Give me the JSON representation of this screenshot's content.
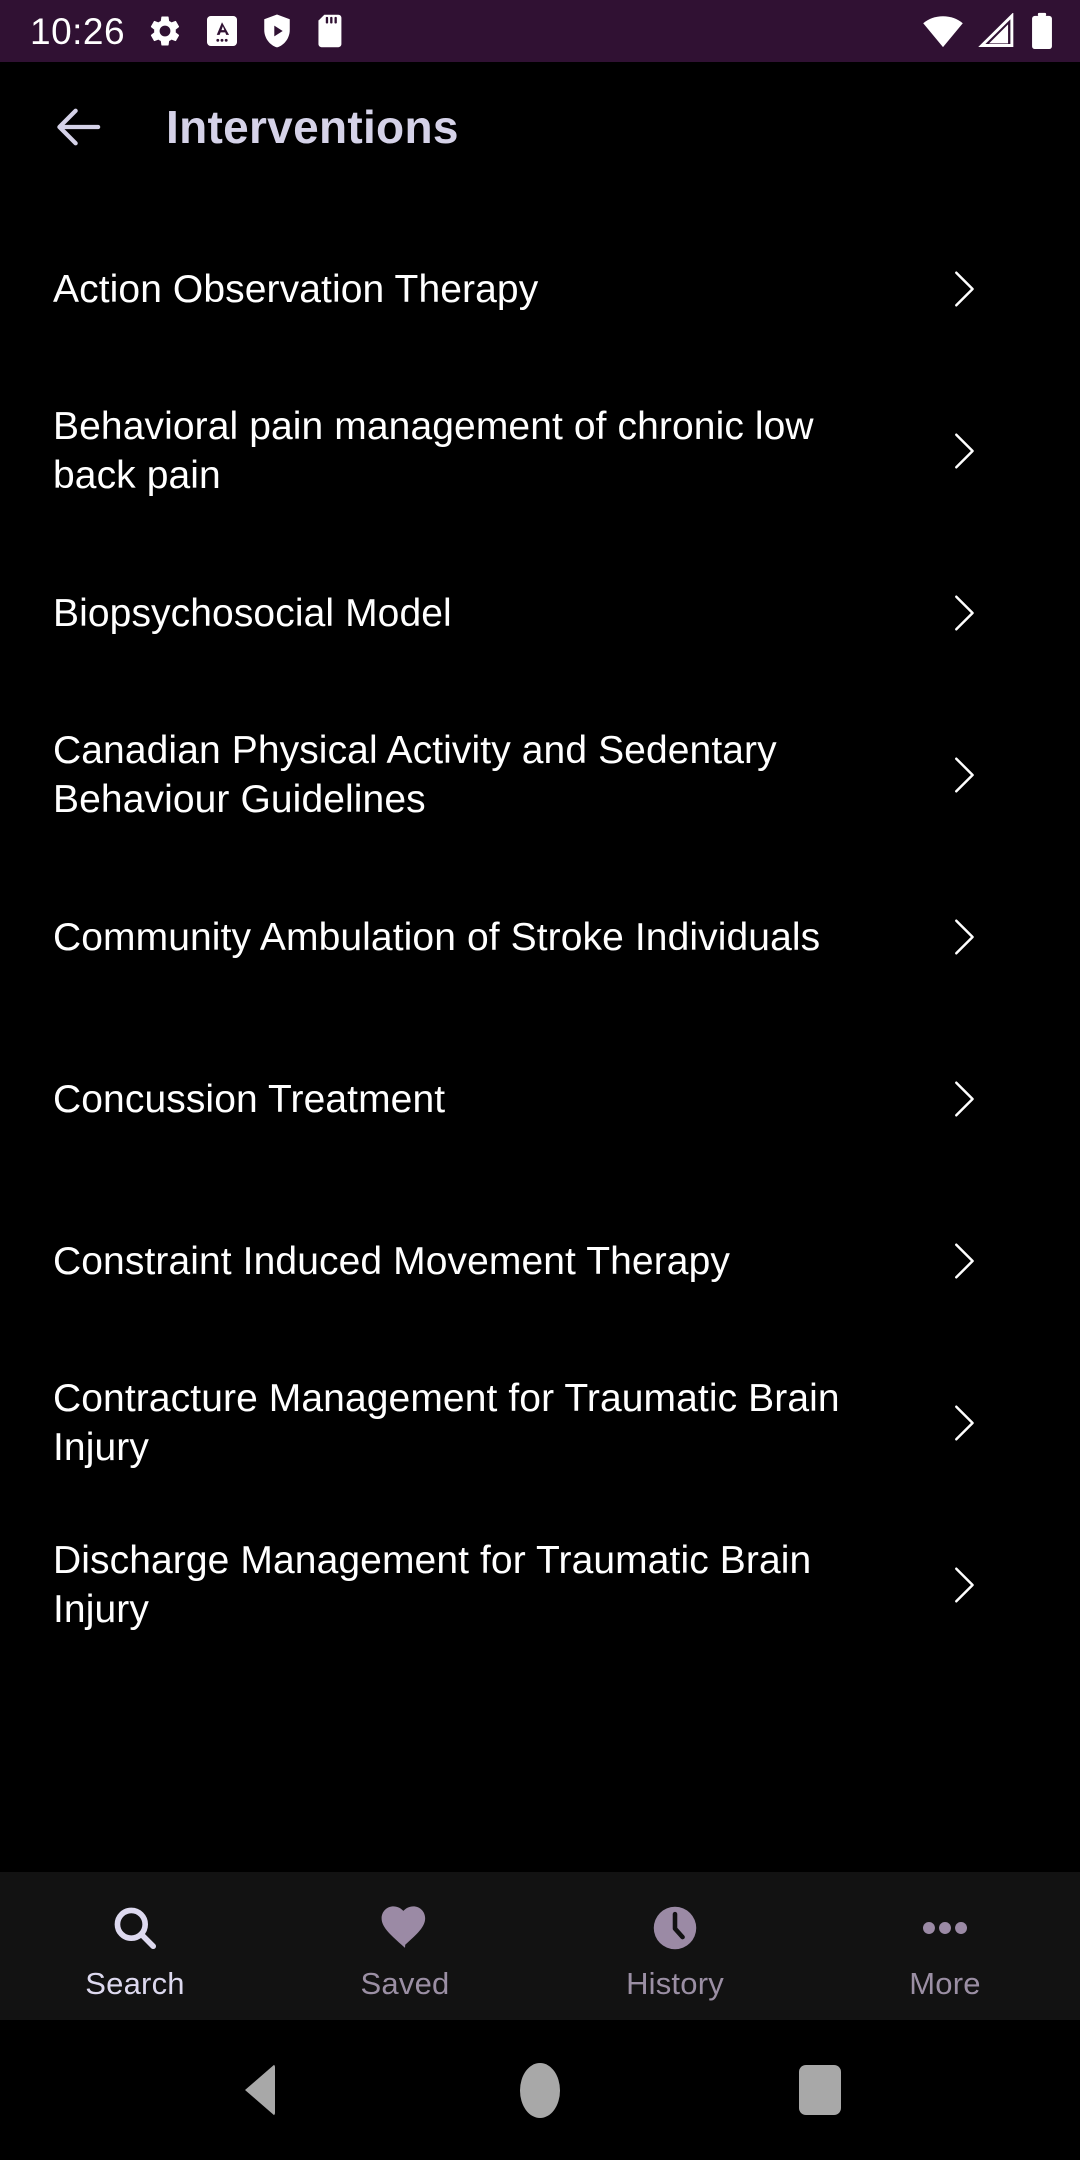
{
  "status_bar": {
    "time": "10:26",
    "background_color": "#301133",
    "left_icons": [
      "gear-icon",
      "a-card-icon",
      "shield-play-icon",
      "sd-card-icon"
    ],
    "right_icons": [
      "wifi-icon",
      "cell-signal-icon",
      "battery-icon"
    ]
  },
  "app_bar": {
    "back_icon": "arrow-left-icon",
    "title": "Interventions",
    "title_color": "#d5d2e8"
  },
  "list": {
    "chevron_icon": "chevron-right-icon",
    "items": [
      {
        "label": "Action Observation Therapy"
      },
      {
        "label": "Behavioral pain management of chronic low back pain"
      },
      {
        "label": "Biopsychosocial Model"
      },
      {
        "label": "Canadian Physical Activity and Sedentary Behaviour Guidelines"
      },
      {
        "label": "Community Ambulation of Stroke Individuals"
      },
      {
        "label": "Concussion Treatment"
      },
      {
        "label": "Constraint Induced Movement Therapy"
      },
      {
        "label": "Contracture Management for Traumatic Brain Injury"
      },
      {
        "label": "Discharge Management for Traumatic Brain Injury"
      }
    ]
  },
  "bottom_nav": {
    "background_color": "#121212",
    "active_color": "#ddd9ef",
    "inactive_color": "#9b8fa4",
    "items": [
      {
        "label": "Search",
        "icon": "search-icon",
        "active": true
      },
      {
        "label": "Saved",
        "icon": "heart-icon",
        "active": false
      },
      {
        "label": "History",
        "icon": "clock-icon",
        "active": false
      },
      {
        "label": "More",
        "icon": "more-dots-icon",
        "active": false
      }
    ]
  },
  "android_nav": {
    "back_label": "Back",
    "home_label": "Home",
    "recents_label": "Recents"
  }
}
